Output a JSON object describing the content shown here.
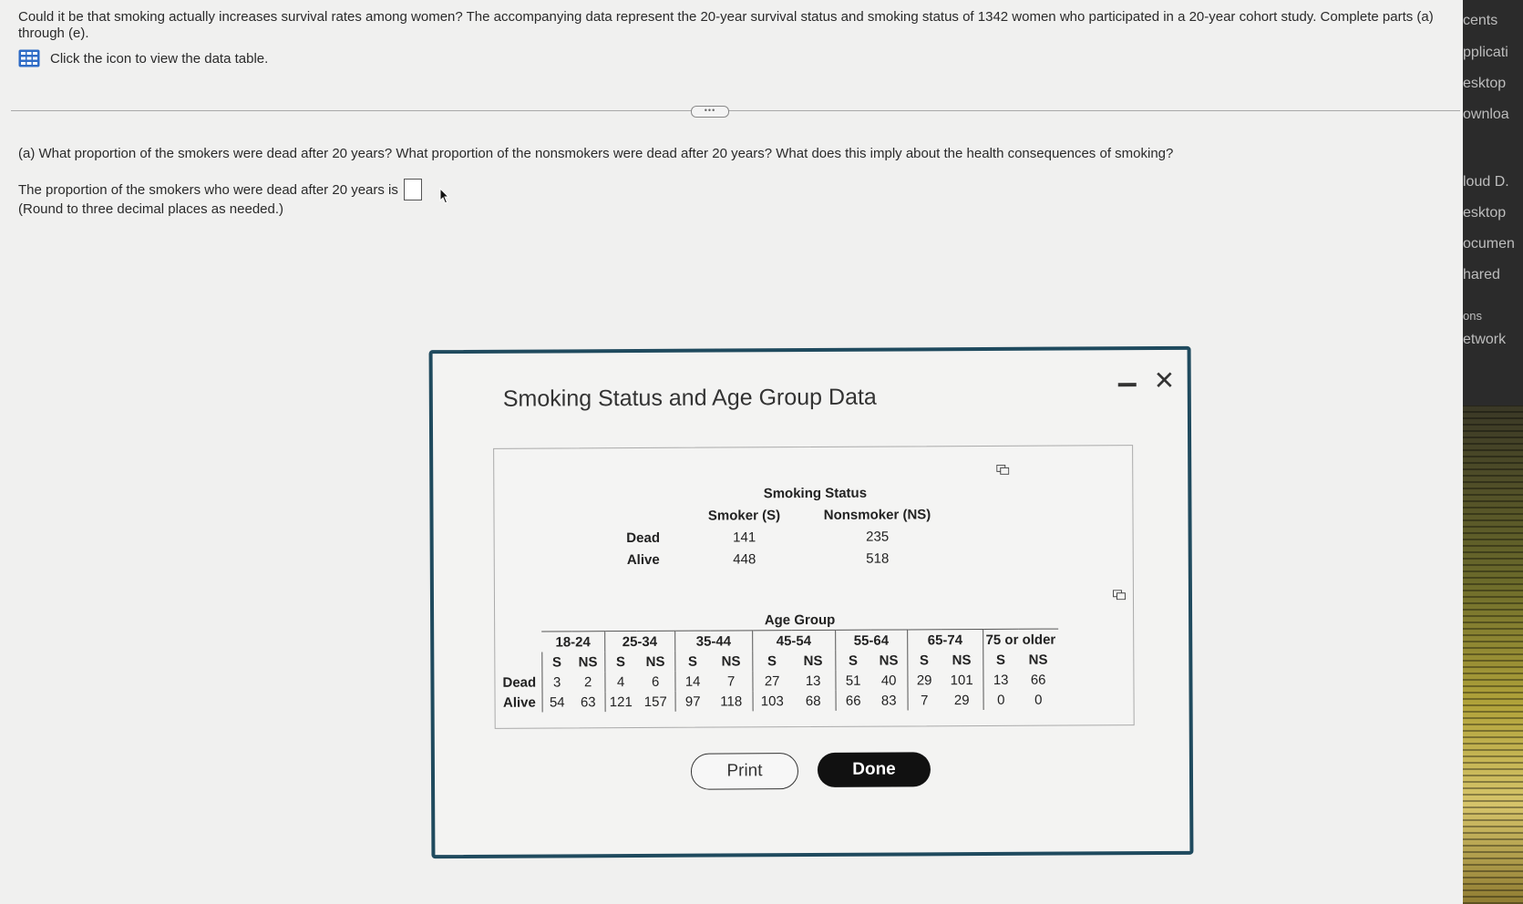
{
  "question": {
    "intro": "Could it be that smoking actually increases survival rates among women? The accompanying data represent the 20-year survival status and smoking status of 1342 women who participated in a 20-year cohort study. Complete parts (a) through (e).",
    "data_link": "Click the icon to view the data table.",
    "part_a": "(a) What proportion of the smokers were dead after 20 years? What proportion of the nonsmokers were dead after 20 years? What does this imply about the health consequences of smoking?",
    "answer_prompt": "The proportion of the smokers who were dead after 20 years is",
    "round_note": "(Round to three decimal places as needed.)"
  },
  "side_panel": [
    "cents",
    "pplicati",
    "esktop",
    "ownloa",
    "loud D.",
    "esktop",
    "ocumen",
    "hared",
    "ons",
    "etwork"
  ],
  "dialog": {
    "title": "Smoking Status and Age Group Data",
    "print_label": "Print",
    "done_label": "Done"
  },
  "table1": {
    "header": "Smoking Status",
    "cols": [
      "Smoker (S)",
      "Nonsmoker (NS)"
    ],
    "rows": [
      {
        "label": "Dead",
        "s": "141",
        "ns": "235"
      },
      {
        "label": "Alive",
        "s": "448",
        "ns": "518"
      }
    ]
  },
  "table2": {
    "header": "Age Group",
    "groups": [
      "18-24",
      "25-34",
      "35-44",
      "45-54",
      "55-64",
      "65-74",
      "75 or older"
    ],
    "sub": [
      "S",
      "NS"
    ],
    "rows": [
      {
        "label": "Dead",
        "values": [
          "3",
          "2",
          "4",
          "6",
          "14",
          "7",
          "27",
          "13",
          "51",
          "40",
          "29",
          "101",
          "13",
          "66"
        ]
      },
      {
        "label": "Alive",
        "values": [
          "54",
          "63",
          "121",
          "157",
          "97",
          "118",
          "103",
          "68",
          "66",
          "83",
          "7",
          "29",
          "0",
          "0"
        ]
      }
    ]
  }
}
